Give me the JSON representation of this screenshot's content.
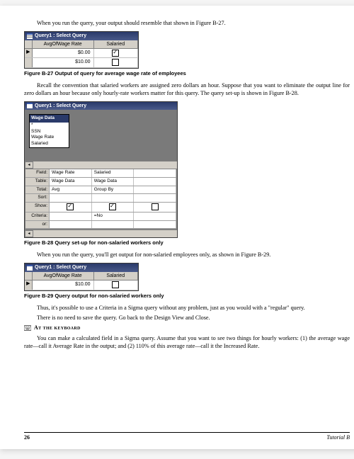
{
  "intro": "When you run the query, your output should resemble that shown in Figure B-27.",
  "fig27": {
    "title": "Query1 : Select Query",
    "headers": [
      "AvgOfWage Rate",
      "Salaried"
    ],
    "rows": [
      {
        "rate": "$0.00",
        "salaried": true
      },
      {
        "rate": "$10.00",
        "salaried": false
      }
    ],
    "caption": "Figure B-27    Output of query for average wage rate of employees"
  },
  "para2": "Recall the convention that salaried workers are assigned zero dollars an hour. Suppose that you want to eliminate the output line for zero dollars an hour because only hourly-rate workers matter for this query. The query set-up is shown in Figure B-28.",
  "fig28": {
    "title": "Query1 : Select Query",
    "field_list_title": "Wage Data",
    "field_list": [
      "*",
      "SSN",
      "Wage Rate",
      "Salaried"
    ],
    "grid_labels": [
      "Field:",
      "Table:",
      "Total:",
      "Sort:",
      "Show:",
      "Criteria:",
      "or:"
    ],
    "cols": [
      {
        "field": "Wage Rate",
        "table": "Wage Data",
        "total": "Avg",
        "sort": "",
        "show": true,
        "criteria": "",
        "or": ""
      },
      {
        "field": "Salaried",
        "table": "Wage Data",
        "total": "Group By",
        "sort": "",
        "show": true,
        "criteria": "=No",
        "or": ""
      }
    ],
    "caption": "Figure B-28    Query set-up for non-salaried workers only"
  },
  "para3": "When you run the query, you'll get output for non-salaried employees only, as shown in Figure B-29.",
  "fig29": {
    "title": "Query1 : Select Query",
    "headers": [
      "AvgOfWage Rate",
      "Salaried"
    ],
    "rows": [
      {
        "rate": "$10.00",
        "salaried": false
      }
    ],
    "caption": "Figure B-29    Query output for non-salaried workers only"
  },
  "para4": "Thus, it's possible to use a Criteria in a Sigma query without any problem, just as you would with a \"regular\" query.",
  "para5": "There is no need to save the query. Go back to the Design View and Close.",
  "kb_heading": "At the keyboard",
  "para6": "You can make a calculated field in a Sigma query. Assume that you want to see two things for hourly workers: (1) the average wage rate—call it Average Rate in the output; and (2) 110% of this average rate—call it the Increased Rate.",
  "footer": {
    "page": "26",
    "tutorial": "Tutorial B"
  }
}
